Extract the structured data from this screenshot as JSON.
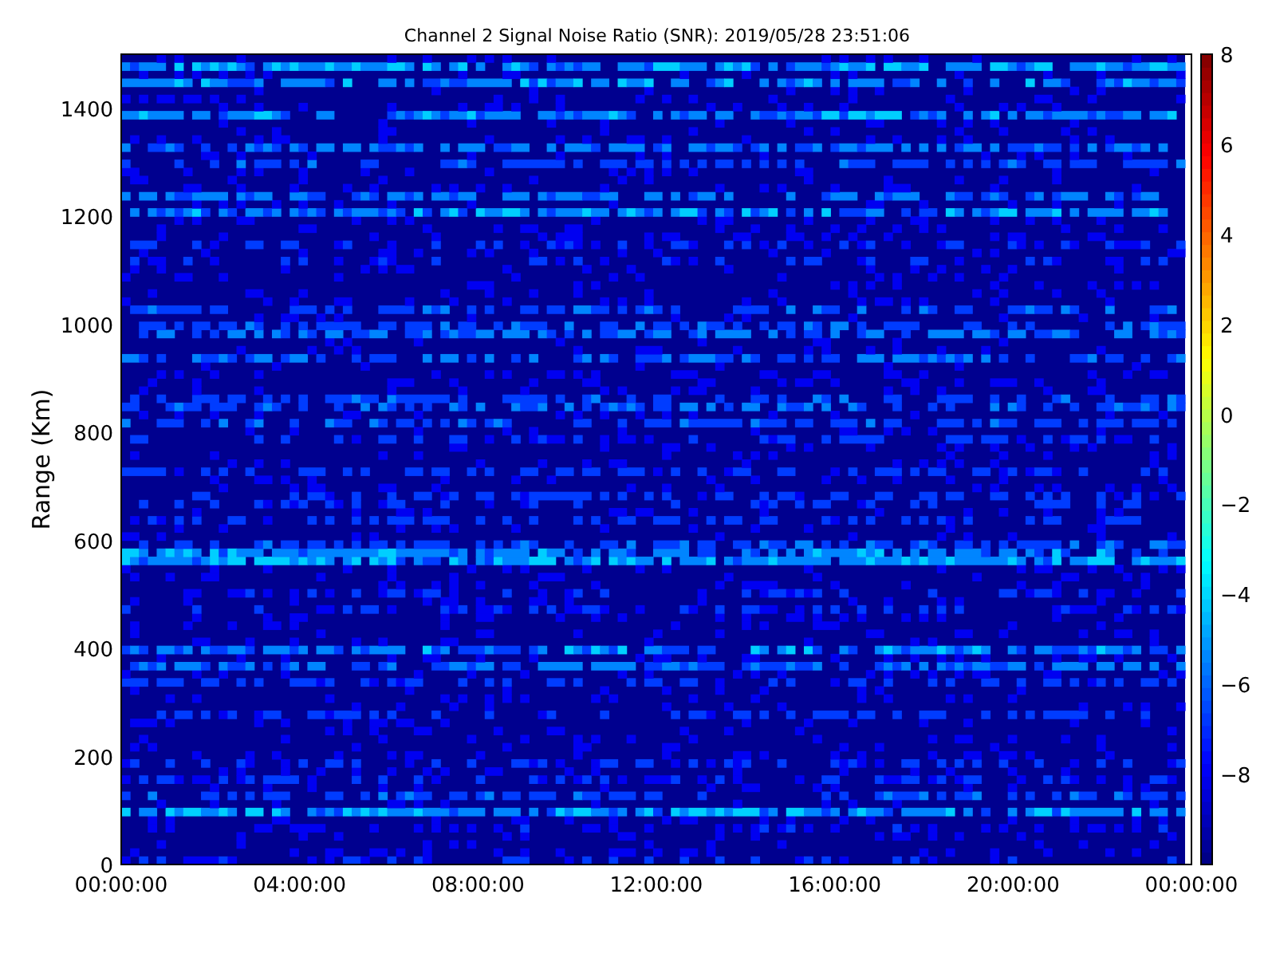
{
  "title": "Channel 2 Signal Noise Ratio (SNR): 2019/05/28 23:51:06",
  "ylabel": "Range (Km)",
  "yticks": [
    "1400",
    "1200",
    "1000",
    "800",
    "600",
    "400",
    "200",
    "0"
  ],
  "xticks": [
    "00:00:00",
    "04:00:00",
    "08:00:00",
    "12:00:00",
    "16:00:00",
    "20:00:00",
    "00:00:00"
  ],
  "colorbar_ticks": [
    "8",
    "6",
    "4",
    "2",
    "0",
    "−2",
    "−4",
    "−6",
    "−8"
  ]
}
